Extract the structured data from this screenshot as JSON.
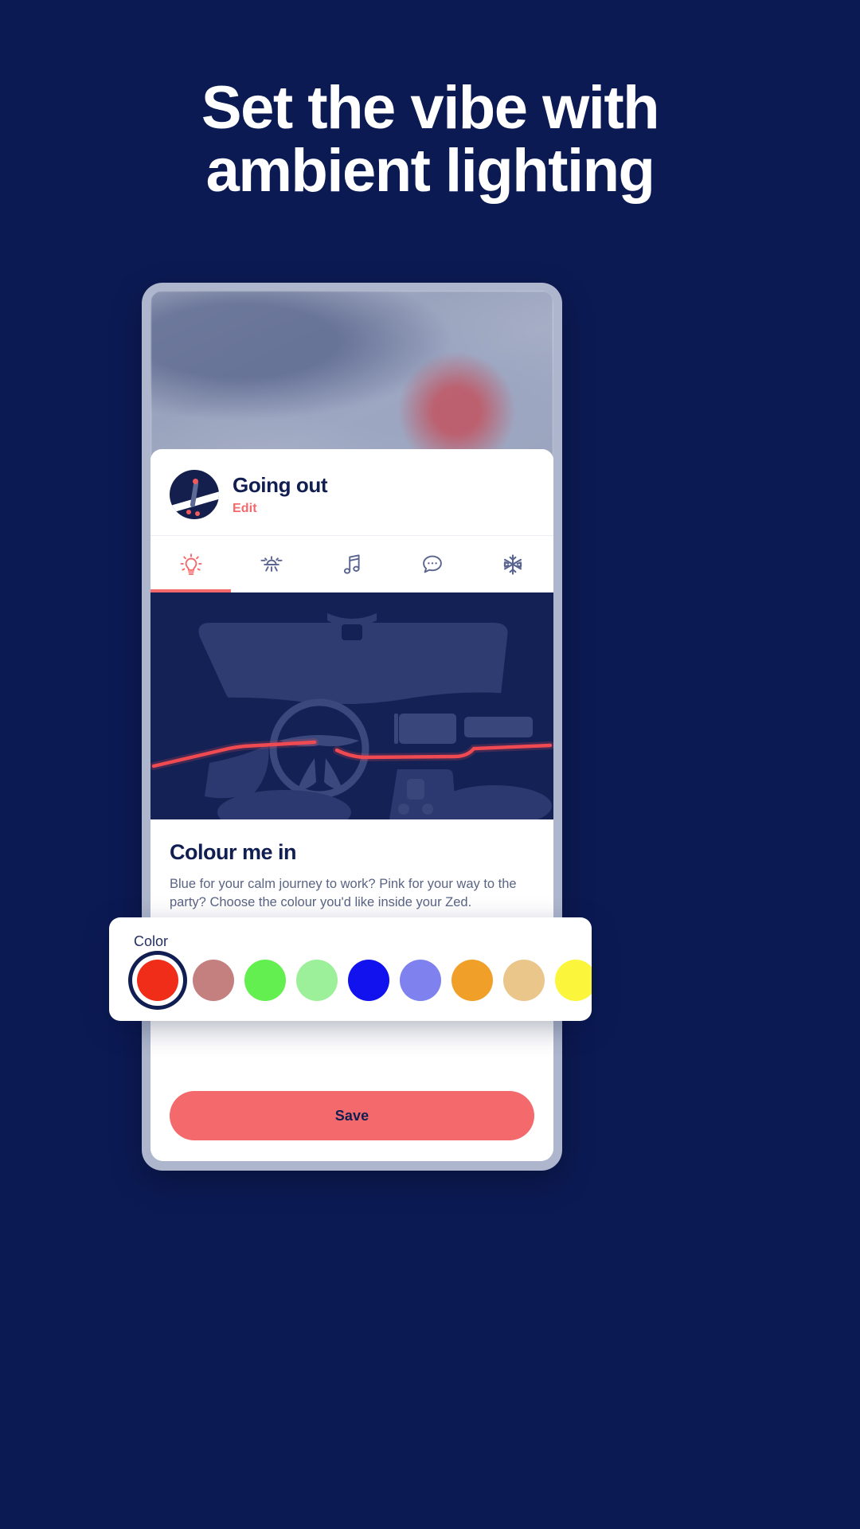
{
  "headline": {
    "line1": "Set the vibe with",
    "line2": "ambient lighting"
  },
  "theme": {
    "background": "#0c1a54",
    "accent": "#f4696b",
    "navy": "#111e51",
    "card": "#ffffff"
  },
  "scene": {
    "title": "Going out",
    "edit_label": "Edit",
    "avatar_name": "going-out-avatar"
  },
  "tabs": [
    {
      "id": "lighting",
      "icon": "lightbulb-icon",
      "active": true
    },
    {
      "id": "reading",
      "icon": "reading-light-icon",
      "active": false
    },
    {
      "id": "music",
      "icon": "music-note-icon",
      "active": false
    },
    {
      "id": "messages",
      "icon": "chat-bubble-icon",
      "active": false
    },
    {
      "id": "climate",
      "icon": "snowflake-icon",
      "active": false
    }
  ],
  "illustration": {
    "name": "car-dashboard-illustration",
    "background": "#132154",
    "shape_color": "#2b386c",
    "light_strip_color": "#ef4a52"
  },
  "colour_section": {
    "title": "Colour me in",
    "description": "Blue for your calm journey to work? Pink for your way to the party? Choose the colour you'd like inside your Zed."
  },
  "picker": {
    "label": "Color",
    "swatches": [
      {
        "name": "red",
        "hex": "#f02d18",
        "selected": true
      },
      {
        "name": "dusty-rose",
        "hex": "#c47f7f",
        "selected": false
      },
      {
        "name": "bright-green",
        "hex": "#63ef4f",
        "selected": false
      },
      {
        "name": "light-green",
        "hex": "#9cf09a",
        "selected": false
      },
      {
        "name": "blue",
        "hex": "#1212ee",
        "selected": false
      },
      {
        "name": "periwinkle",
        "hex": "#7e81ee",
        "selected": false
      },
      {
        "name": "orange",
        "hex": "#f0a028",
        "selected": false
      },
      {
        "name": "tan",
        "hex": "#eac68b",
        "selected": false
      },
      {
        "name": "yellow",
        "hex": "#fbf63c",
        "selected": false
      },
      {
        "name": "pale-yellow",
        "hex": "#eff0a8",
        "selected": false
      },
      {
        "name": "cyan",
        "hex": "#69f3fb",
        "selected": false
      }
    ]
  },
  "actions": {
    "save_label": "Save"
  }
}
